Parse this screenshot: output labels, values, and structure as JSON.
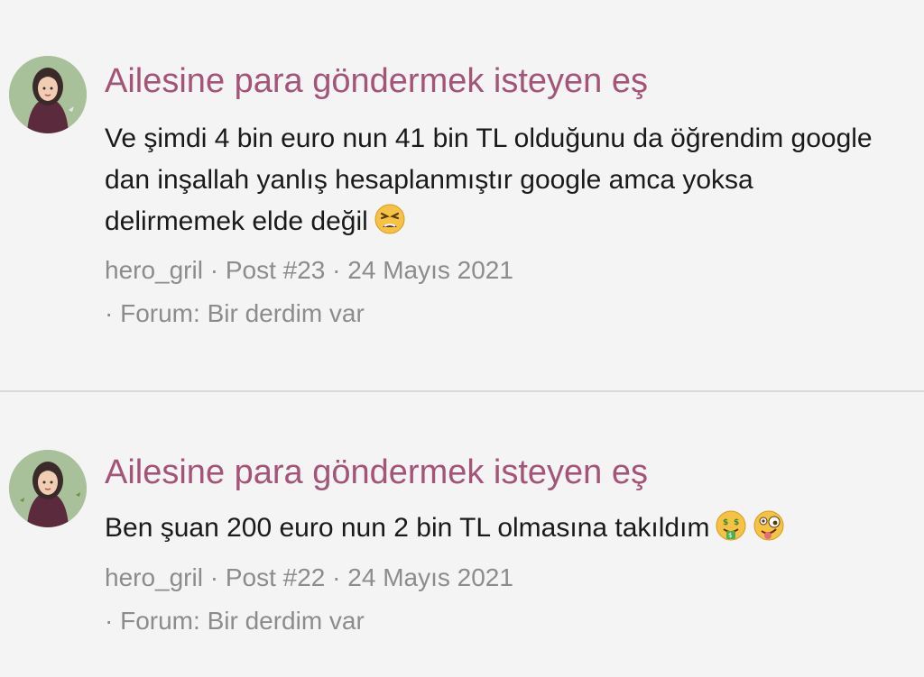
{
  "posts": [
    {
      "avatar_icon": "user-avatar-illustration",
      "title": "Ailesine para göndermek isteyen eş",
      "body": "Ve şimdi 4 bin euro nun 41 bin TL olduğunu da öğrendim google dan inşallah yanlış hesaplanmıştır google amca yoksa delirmemek elde değil",
      "emojis": [
        "tired-face-emoji"
      ],
      "author": "hero_gril",
      "post_number": "Post #23",
      "date": "24 Mayıs 2021",
      "forum": "Forum: Bir derdim var"
    },
    {
      "avatar_icon": "user-avatar-illustration",
      "title": "Ailesine para göndermek isteyen eş",
      "body": "Ben şuan 200 euro nun 2 bin TL olmasına takıldım",
      "emojis": [
        "money-mouth-face-emoji",
        "zany-face-emoji"
      ],
      "author": "hero_gril",
      "post_number": "Post #22",
      "date": "24 Mayıs 2021",
      "forum": "Forum: Bir derdim var"
    }
  ],
  "separator": " · ",
  "colors": {
    "background": "#f4f4f4",
    "title": "#a35478",
    "meta": "#8c8c8c",
    "divider": "#d9d9d9"
  }
}
